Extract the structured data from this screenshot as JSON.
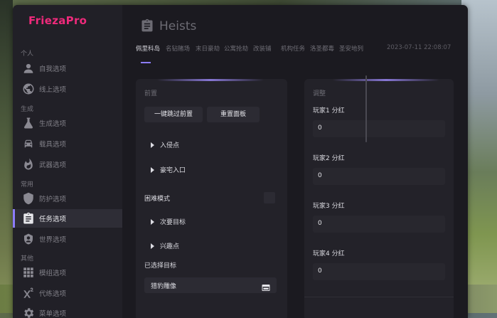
{
  "app": {
    "brand": "FriezaPro",
    "brand_color": "#ee2a7b",
    "accent_color": "#8c7cff"
  },
  "sidebar": {
    "sections": [
      "个人",
      "生成",
      "常用",
      "其他"
    ],
    "items": [
      {
        "label": "自我选项",
        "icon": "person-icon",
        "active": false
      },
      {
        "label": "线上选项",
        "icon": "globe-icon",
        "active": false
      },
      {
        "label": "生成选项",
        "icon": "flask-icon",
        "active": false
      },
      {
        "label": "载具选项",
        "icon": "car-icon",
        "active": false
      },
      {
        "label": "武器选项",
        "icon": "fire-icon",
        "active": false
      },
      {
        "label": "防护选项",
        "icon": "shield-icon",
        "active": false
      },
      {
        "label": "任务选项",
        "icon": "clipboard-icon",
        "active": true
      },
      {
        "label": "世界选项",
        "icon": "earth-icon",
        "active": false
      },
      {
        "label": "模组选项",
        "icon": "grid-icon",
        "active": false
      },
      {
        "label": "代练选项",
        "icon": "superscript-icon",
        "active": false
      },
      {
        "label": "菜单选项",
        "icon": "gear-icon",
        "active": false
      }
    ]
  },
  "header": {
    "title": "Heists",
    "title_icon": "clipboard-icon",
    "timestamp": "2023-07-11 22:08:07",
    "tabs": [
      "佩里科岛",
      "名钻赌场",
      "末日豪劫",
      "公寓抢劫",
      "改装铺",
      "机构任务",
      "洛圣都毒",
      "圣安地列"
    ],
    "active_tab": 0
  },
  "left_panel": {
    "heading": "前置",
    "skip_button": "一键跳过前置",
    "reset_button": "重置面板",
    "entry_point": "入侵点",
    "mansion_entrance": "豪宅入口",
    "hard_mode_label": "困难模式",
    "secondary_target": "次要目标",
    "points_of_interest": "兴趣点",
    "selected_target_label": "已选择目标",
    "selected_target_value": "猎豹雕像",
    "select_icon": "card-icon"
  },
  "right_panel": {
    "heading": "调整",
    "fields": [
      {
        "label": "玩家1 分红",
        "value": "0"
      },
      {
        "label": "玩家2 分红",
        "value": "0"
      },
      {
        "label": "玩家3 分红",
        "value": "0"
      },
      {
        "label": "玩家4 分红",
        "value": "0"
      }
    ]
  }
}
